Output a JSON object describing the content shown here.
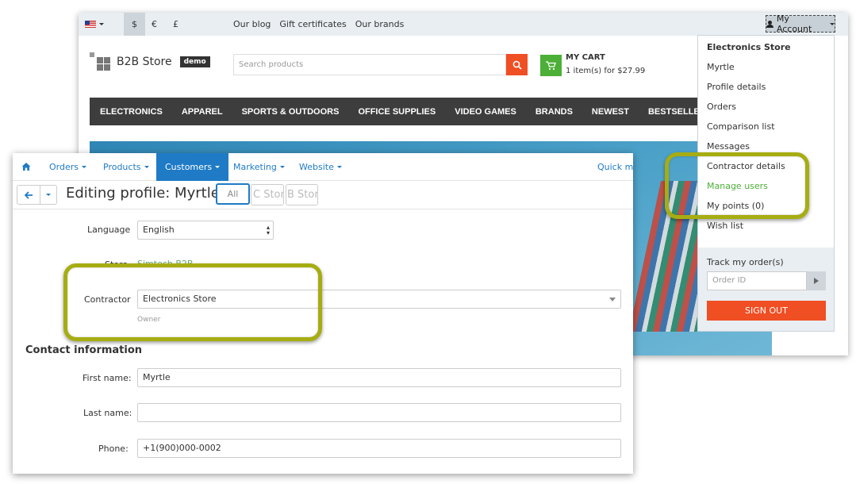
{
  "store": {
    "currencies": [
      "$",
      "€",
      "£"
    ],
    "top_links": [
      "Our blog",
      "Gift certificates",
      "Our brands"
    ],
    "account_label": "My Account",
    "logo_name": "B2B Store",
    "logo_badge": "demo",
    "search_placeholder": "Search products",
    "cart_title": "MY CART",
    "cart_summary": "1 item(s) for $27.99",
    "categories": [
      "ELECTRONICS",
      "APPAREL",
      "SPORTS & OUTDOORS",
      "OFFICE SUPPLIES",
      "VIDEO GAMES",
      "BRANDS",
      "NEWEST",
      "BESTSELLERS"
    ],
    "dropdown": {
      "company": "Electronics Store",
      "items": [
        "Myrtle",
        "Profile details",
        "Orders",
        "Comparison list",
        "Messages",
        "Contractor details",
        "Manage users",
        "My points (0)",
        "Wish list"
      ],
      "track_label": "Track my order(s)",
      "order_placeholder": "Order ID",
      "sign_out": "SIGN OUT"
    }
  },
  "admin": {
    "nav": [
      "Orders",
      "Products",
      "Customers",
      "Marketing",
      "Website"
    ],
    "quick_menu": "Quick me",
    "title": "Editing profile: Myrtle",
    "store_tabs": [
      "All",
      "C Store",
      "B Store"
    ],
    "form": {
      "language_label": "Language",
      "language_value": "English",
      "store_label": "Store",
      "store_value": "Simtech B2B",
      "contractor_label": "Contractor",
      "contractor_value": "Electronics Store",
      "contractor_hint": "Owner",
      "section_title": "Contact information",
      "first_name_label": "First name:",
      "first_name_value": "Myrtle",
      "last_name_label": "Last name:",
      "last_name_value": "",
      "phone_label": "Phone:",
      "phone_value": "+1(900)000-0002"
    }
  },
  "colors": {
    "accent_blue": "#1f7bc6",
    "orange": "#f04e23",
    "green": "#4caf37",
    "highlight": "#a6ad12"
  }
}
